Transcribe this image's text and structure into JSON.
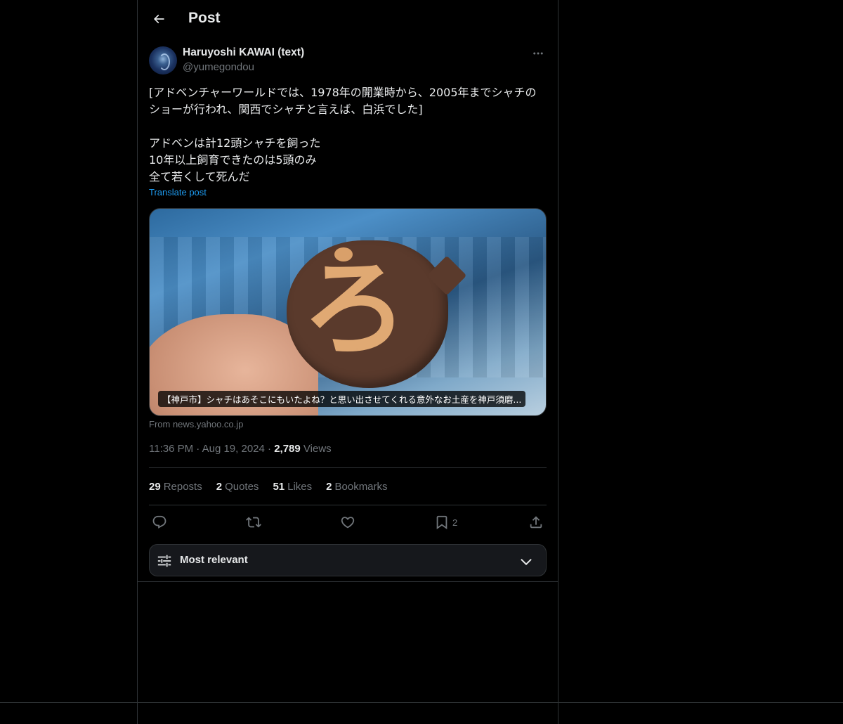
{
  "header": {
    "title": "Post",
    "back_icon": "arrow-left-icon"
  },
  "post": {
    "author": {
      "name": "Haruyoshi KAWAI (text)",
      "handle": "@yumegondou"
    },
    "text": "[アドベンチャーワールドでは、1978年の開業時から、2005年までシャチのショーが行われ、関西でシャチと言えば、白浜でした]\n\nアドベンは計12頭シャチを飼った\n10年以上飼育できたのは5頭のみ\n全て若くして死んだ",
    "translate_label": "Translate post",
    "card": {
      "caption": "【神戸市】シャチはあそこにもいたよね？と思い出させてくれる意外なお土産を神戸須磨...",
      "source": "From news.yahoo.co.jp"
    },
    "time": "11:36 PM",
    "date": "Aug 19, 2024",
    "views_count": "2,789",
    "views_label": "Views",
    "stats": {
      "reposts_count": "29",
      "reposts_label": "Reposts",
      "quotes_count": "2",
      "quotes_label": "Quotes",
      "likes_count": "51",
      "likes_label": "Likes",
      "bookmarks_count": "2",
      "bookmarks_label": "Bookmarks"
    },
    "actions": {
      "bookmark_count": "2"
    }
  },
  "sort": {
    "label": "Most relevant"
  },
  "colors": {
    "background": "#000000",
    "text": "#e7e9ea",
    "muted": "#71767b",
    "link": "#1d9bf0",
    "border": "#2f3336"
  }
}
